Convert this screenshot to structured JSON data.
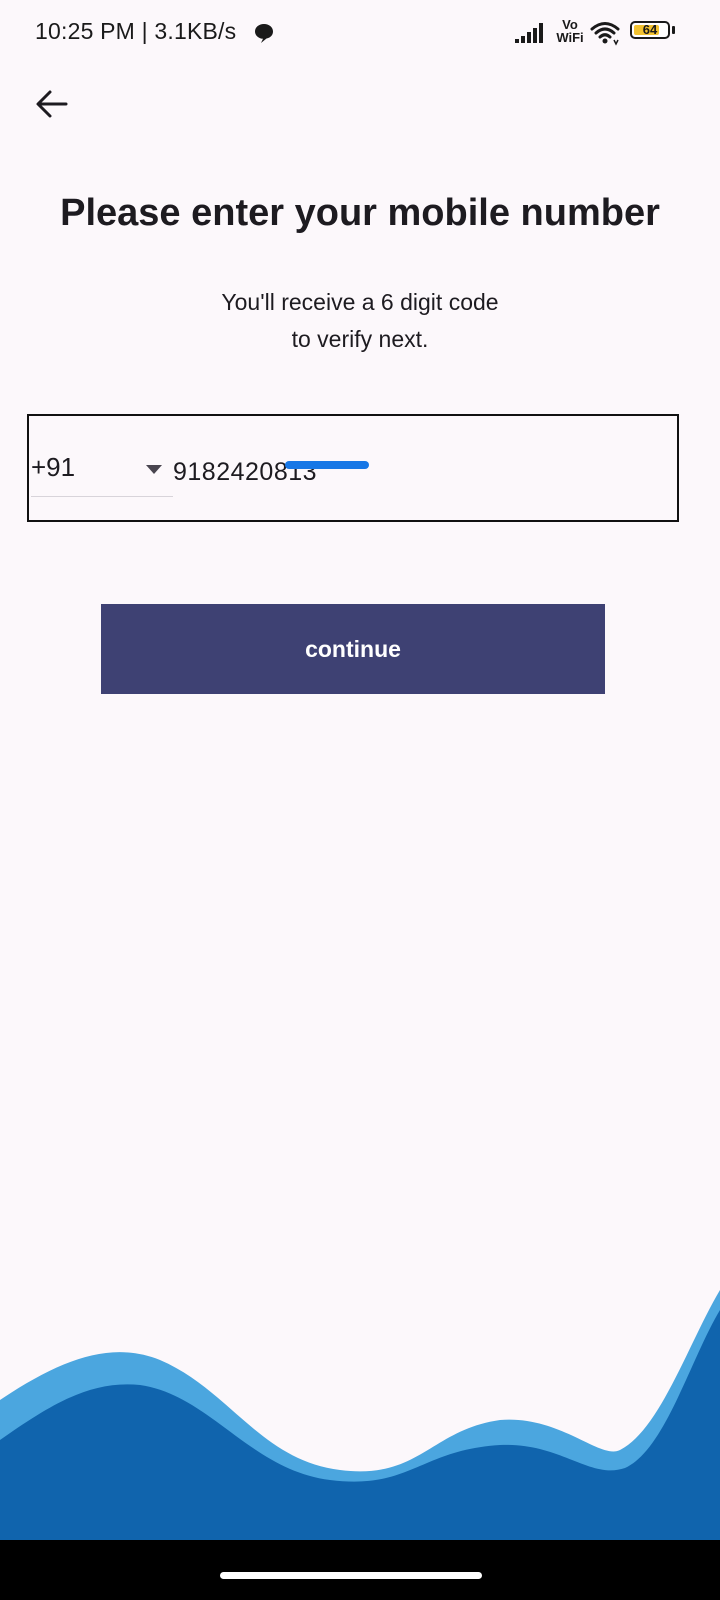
{
  "status_bar": {
    "time": "10:25 PM | 3.1KB/s",
    "vowifi": "Vo\nWiFi",
    "battery": "64",
    "icons": [
      "chat-bubble-icon",
      "signal-icon",
      "wifi-icon",
      "battery-icon"
    ]
  },
  "header": {
    "back_icon": "arrow-left-icon"
  },
  "main": {
    "title": "Please enter your mobile number",
    "subtitle": "You'll receive a 6 digit code\nto verify next.",
    "country_code": "+91",
    "phone_value": "9182420813",
    "continue_label": "continue"
  },
  "colors": {
    "background": "#fcf8fb",
    "button": "#3e4173",
    "wave_light": "#4ba6df",
    "wave_dark": "#1064ad",
    "redaction": "#1777e6"
  }
}
